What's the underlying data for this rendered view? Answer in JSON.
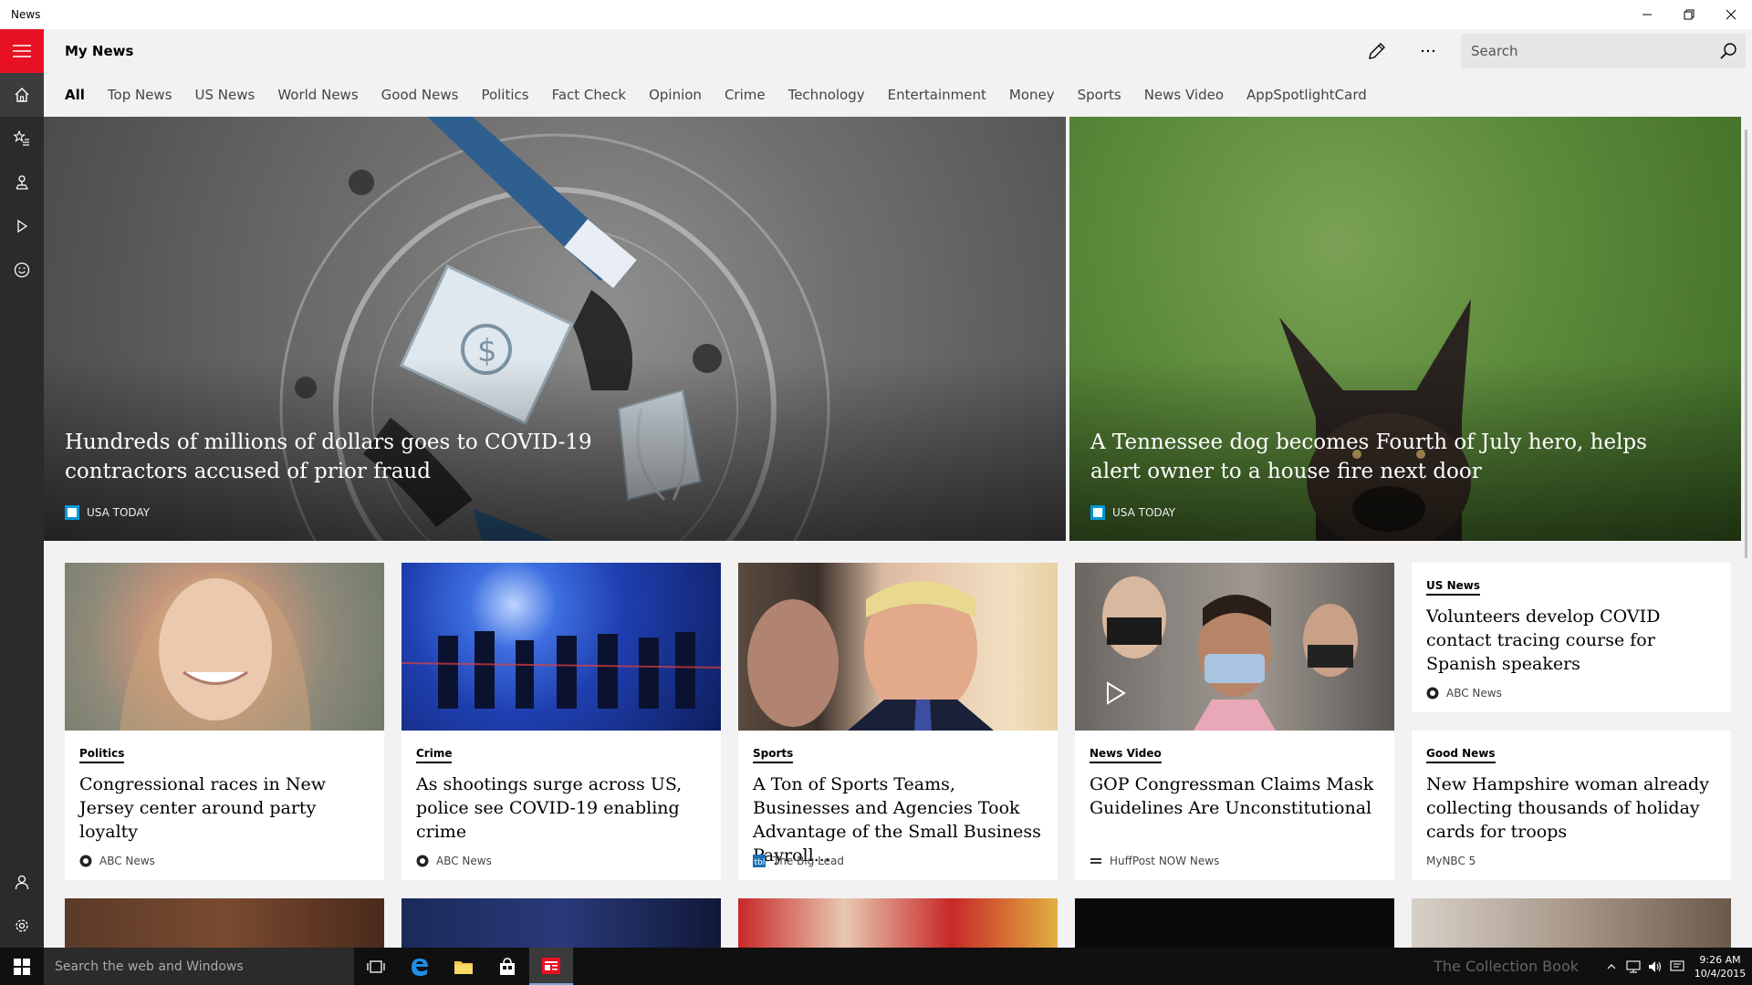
{
  "window": {
    "app_title": "News"
  },
  "header": {
    "title": "My News"
  },
  "search": {
    "placeholder": "Search"
  },
  "tabs": [
    {
      "label": "All",
      "active": true
    },
    {
      "label": "Top News"
    },
    {
      "label": "US News"
    },
    {
      "label": "World News"
    },
    {
      "label": "Good News"
    },
    {
      "label": "Politics"
    },
    {
      "label": "Fact Check"
    },
    {
      "label": "Opinion"
    },
    {
      "label": "Crime"
    },
    {
      "label": "Technology"
    },
    {
      "label": "Entertainment"
    },
    {
      "label": "Money"
    },
    {
      "label": "Sports"
    },
    {
      "label": "News Video"
    },
    {
      "label": "AppSpotlightCard"
    }
  ],
  "hero": [
    {
      "headline": "Hundreds of millions of dollars goes to COVID-19 contractors accused of prior fraud",
      "source": "USA TODAY",
      "image": "covid-money-illustration"
    },
    {
      "headline": "A Tennessee dog becomes Fourth of July hero, helps alert owner to a house fire next door",
      "source": "USA TODAY",
      "image": "dog-on-grass"
    }
  ],
  "cards": [
    {
      "category": "Politics",
      "headline": "Congressional races in New Jersey center around party loyalty",
      "source": "ABC News",
      "image": "smiling-woman-portrait"
    },
    {
      "category": "Crime",
      "headline": "As shootings surge across US, police see COVID-19 enabling crime",
      "source": "ABC News",
      "image": "police-night-scene"
    },
    {
      "category": "Sports",
      "headline": "A Ton of Sports Teams, Businesses and Agencies Took Advantage of the Small Business Payroll...",
      "source": "The Big Lead",
      "image": "men-in-suits"
    },
    {
      "category": "News Video",
      "headline": "GOP Congressman Claims Mask Guidelines Are Unconstitutional",
      "source": "HuffPost NOW News",
      "image": "crowd-with-masks",
      "video": true
    },
    {
      "category": "US News",
      "headline": "Volunteers develop COVID contact tracing course for Spanish speakers",
      "source": "ABC News"
    },
    {
      "category": "Good News",
      "headline": "New Hampshire woman already collecting thousands of holiday cards for troops",
      "source": "MyNBC 5"
    }
  ],
  "taskbar": {
    "search_placeholder": "Search the web and Windows",
    "watermark": "The Collection Book",
    "time": "9:26 AM",
    "date": "10/4/2015"
  },
  "colors": {
    "accent": "#e81123",
    "rail": "#2b2b2b",
    "background": "#f2f2f2",
    "taskbar": "#101010"
  }
}
